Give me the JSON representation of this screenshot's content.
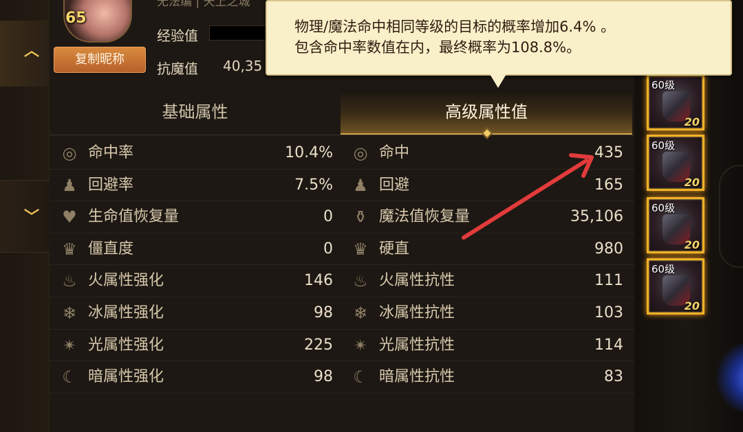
{
  "header": {
    "level": "65",
    "copy_nickname_label": "复制昵称",
    "exp_label": "经验值",
    "anti_magic_label": "抗魔值",
    "anti_magic_value": "40,35",
    "top_cut_text": "无法编 | 天上之城"
  },
  "sidebar": {
    "up_arrow": "︿",
    "down_arrow": "﹀"
  },
  "tabs": {
    "basic": "基础属性",
    "advanced": "高级属性值"
  },
  "tooltip": {
    "line1": "物理/魔法命中相同等级的目标的概率增加6.4% 。",
    "line2": "包含命中率数值在内，最终概率为108.8%。"
  },
  "rows": [
    {
      "left_icon": "target-icon",
      "left_label": "命中率",
      "left_value": "10.4%",
      "right_icon": "target-icon",
      "right_label": "命中",
      "right_value": "435"
    },
    {
      "left_icon": "dodge-icon",
      "left_label": "回避率",
      "left_value": "7.5%",
      "right_icon": "dodge-icon",
      "right_label": "回避",
      "right_value": "165"
    },
    {
      "left_icon": "heart-icon",
      "left_label": "生命值恢复量",
      "left_value": "0",
      "right_icon": "potion-icon",
      "right_label": "魔法值恢复量",
      "right_value": "35,106"
    },
    {
      "left_icon": "stun-icon",
      "left_label": "僵直度",
      "left_value": "0",
      "right_icon": "stun-icon",
      "right_label": "硬直",
      "right_value": "980"
    },
    {
      "left_icon": "fire-icon",
      "left_label": "火属性强化",
      "left_value": "146",
      "right_icon": "fire-icon",
      "right_label": "火属性抗性",
      "right_value": "111"
    },
    {
      "left_icon": "ice-icon",
      "left_label": "冰属性强化",
      "left_value": "98",
      "right_icon": "ice-icon",
      "right_label": "冰属性抗性",
      "right_value": "103"
    },
    {
      "left_icon": "light-icon",
      "left_label": "光属性强化",
      "left_value": "225",
      "right_icon": "light-icon",
      "right_label": "光属性抗性",
      "right_value": "114"
    },
    {
      "left_icon": "dark-moon-icon",
      "left_label": "暗属性强化",
      "left_value": "98",
      "right_icon": "dark-moon-icon",
      "right_label": "暗属性抗性",
      "right_value": "83"
    }
  ],
  "equipment": [
    {
      "level": "60级",
      "count": "20"
    },
    {
      "level": "60级",
      "count": "20"
    },
    {
      "level": "60级",
      "count": "20"
    },
    {
      "level": "60级",
      "count": "20"
    }
  ],
  "colors": {
    "accent_gold": "#d5a54a",
    "tooltip_bg": "#f9efc9",
    "annotation_arrow": "#e23b3b",
    "button_orange": "#c8733a"
  }
}
